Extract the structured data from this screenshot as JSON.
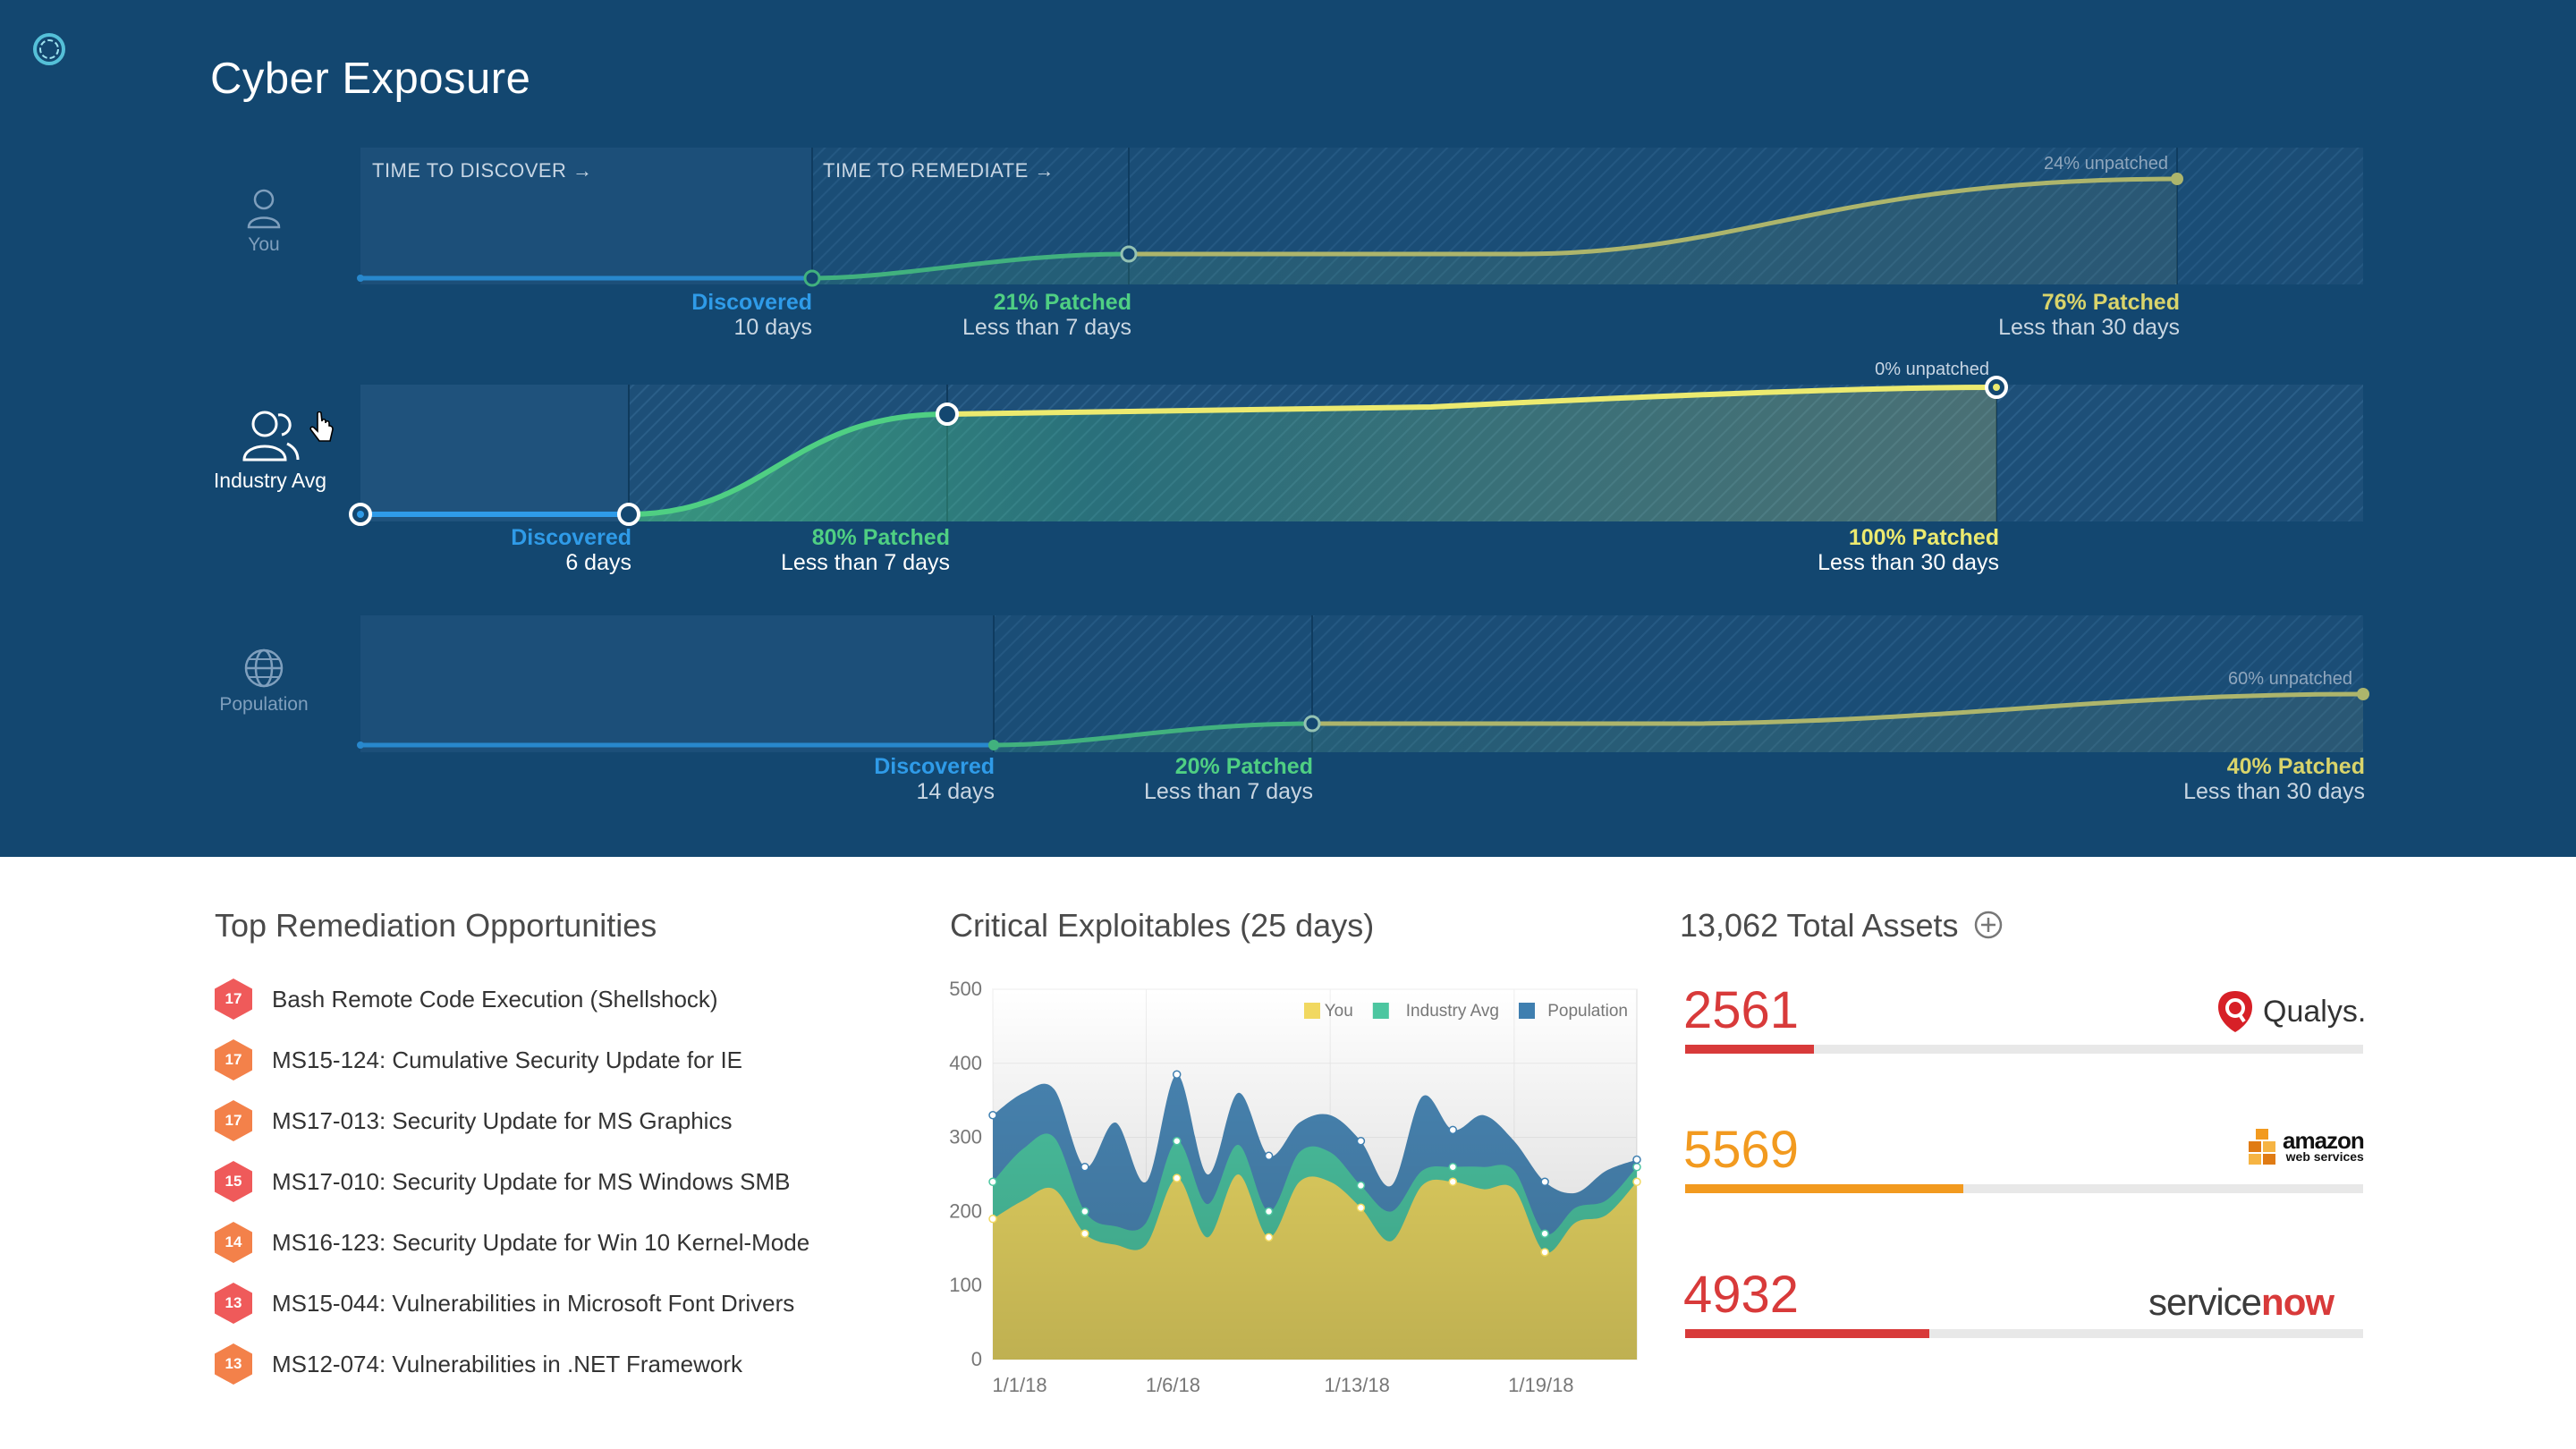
{
  "page": {
    "title": "Cyber Exposure"
  },
  "exposure": {
    "steps": {
      "discover": "TIME TO DISCOVER →",
      "remediate": "TIME TO REMEDIATE →"
    },
    "rows": [
      {
        "key": "you",
        "label": "You",
        "unpatched": "24% unpatched",
        "discovered": {
          "title": "Discovered",
          "sub": "10 days"
        },
        "patch_a": {
          "title": "21% Patched",
          "sub": "Less than 7 days"
        },
        "patch_b": {
          "title": "76% Patched",
          "sub": "Less than 30 days"
        }
      },
      {
        "key": "industry",
        "label": "Industry Avg",
        "unpatched": "0% unpatched",
        "discovered": {
          "title": "Discovered",
          "sub": "6 days"
        },
        "patch_a": {
          "title": "80% Patched",
          "sub": "Less than 7 days"
        },
        "patch_b": {
          "title": "100% Patched",
          "sub": "Less than 30 days"
        }
      },
      {
        "key": "population",
        "label": "Population",
        "unpatched": "60% unpatched",
        "discovered": {
          "title": "Discovered",
          "sub": "14 days"
        },
        "patch_a": {
          "title": "20% Patched",
          "sub": "Less than 7 days"
        },
        "patch_b": {
          "title": "40% Patched",
          "sub": "Less than 30 days"
        }
      }
    ],
    "colors": {
      "blue": "#2f9be8",
      "green": "#4fcf83",
      "yellow": "#e9e56b"
    }
  },
  "remediation": {
    "title": "Top Remediation Opportunities",
    "items": [
      {
        "score": "17",
        "text": "Bash Remote Code Execution (Shellshock)",
        "color": "#ef5a5a"
      },
      {
        "score": "17",
        "text": "MS15-124: Cumulative Security Update for IE",
        "color": "#f3814a"
      },
      {
        "score": "17",
        "text": "MS17-013: Security Update for MS Graphics",
        "color": "#f3814a"
      },
      {
        "score": "15",
        "text": "MS17-010: Security Update for MS Windows SMB",
        "color": "#ef5a5a"
      },
      {
        "score": "14",
        "text": "MS16-123: Security Update for Win 10 Kernel-Mode",
        "color": "#f3814a"
      },
      {
        "score": "13",
        "text": "MS15-044: Vulnerabilities in Microsoft Font Drivers",
        "color": "#ef5a5a"
      },
      {
        "score": "13",
        "text": "MS12-074: Vulnerabilities in .NET Framework",
        "color": "#f3814a"
      }
    ]
  },
  "chart_data": {
    "type": "area",
    "title": "Critical Exploitables (25 days)",
    "xlabel": "",
    "ylabel": "",
    "ylim": [
      0,
      500
    ],
    "yticks": [
      0,
      100,
      200,
      300,
      400,
      500
    ],
    "x": [
      1,
      2,
      3,
      4,
      5,
      6,
      7,
      8,
      9,
      10,
      11,
      12,
      13,
      14,
      15,
      16,
      17,
      18,
      19,
      20,
      21,
      22
    ],
    "xtick_labels": [
      {
        "x": 1,
        "label": "1/1/18"
      },
      {
        "x": 6,
        "label": "1/6/18"
      },
      {
        "x": 12,
        "label": "1/13/18"
      },
      {
        "x": 18,
        "label": "1/19/18"
      }
    ],
    "stacked": true,
    "legend": "top-right",
    "grid": true,
    "series": [
      {
        "name": "You",
        "color": "#f1d860",
        "values": [
          190,
          215,
          230,
          170,
          155,
          155,
          245,
          165,
          250,
          165,
          240,
          240,
          205,
          160,
          235,
          240,
          230,
          230,
          145,
          185,
          195,
          240
        ]
      },
      {
        "name": "Industry Avg",
        "color": "#4cc6a0",
        "values": [
          50,
          70,
          70,
          30,
          25,
          30,
          50,
          45,
          40,
          35,
          40,
          40,
          30,
          40,
          20,
          20,
          30,
          25,
          25,
          20,
          20,
          20
        ]
      },
      {
        "name": "Population",
        "color": "#3f7fb0",
        "values": [
          90,
          75,
          65,
          60,
          140,
          55,
          90,
          40,
          70,
          75,
          40,
          50,
          60,
          35,
          100,
          50,
          70,
          40,
          70,
          20,
          40,
          10
        ]
      }
    ]
  },
  "assets": {
    "total_label": "13,062 Total Assets",
    "items": [
      {
        "value": "2561",
        "color": "#d83a3a",
        "fraction": 0.19,
        "brand": "Qualys."
      },
      {
        "value": "5569",
        "color": "#f29a1f",
        "fraction": 0.41,
        "brand_top": "amazon",
        "brand_bottom": "web services"
      },
      {
        "value": "4932",
        "color": "#d83a3a",
        "fraction": 0.36,
        "brand_main": "service",
        "brand_accent": "now"
      }
    ]
  }
}
